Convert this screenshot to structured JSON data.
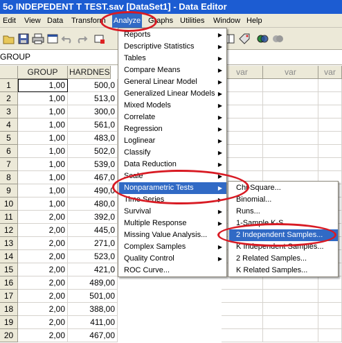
{
  "window": {
    "title": "5o INDEPEDENT T TEST.sav [DataSet1] -      Data Editor"
  },
  "menubar": {
    "items": [
      "Edit",
      "View",
      "Data",
      "Transform",
      "Analyze",
      "Graphs",
      "Utilities",
      "Window",
      "Help"
    ],
    "active": "Analyze"
  },
  "varbar": {
    "name": "GROUP"
  },
  "grid": {
    "columns": [
      "GROUP",
      "HARDNES",
      "var",
      "var",
      "var"
    ],
    "rows": [
      {
        "n": "1",
        "group": "1,00",
        "hardness": "500,0"
      },
      {
        "n": "2",
        "group": "1,00",
        "hardness": "513,0"
      },
      {
        "n": "3",
        "group": "1,00",
        "hardness": "300,0"
      },
      {
        "n": "4",
        "group": "1,00",
        "hardness": "561,0"
      },
      {
        "n": "5",
        "group": "1,00",
        "hardness": "483,0"
      },
      {
        "n": "6",
        "group": "1,00",
        "hardness": "502,0"
      },
      {
        "n": "7",
        "group": "1,00",
        "hardness": "539,0"
      },
      {
        "n": "8",
        "group": "1,00",
        "hardness": "467,0"
      },
      {
        "n": "9",
        "group": "1,00",
        "hardness": "490,0"
      },
      {
        "n": "10",
        "group": "1,00",
        "hardness": "480,0"
      },
      {
        "n": "11",
        "group": "2,00",
        "hardness": "392,0"
      },
      {
        "n": "12",
        "group": "2,00",
        "hardness": "445,0"
      },
      {
        "n": "13",
        "group": "2,00",
        "hardness": "271,0"
      },
      {
        "n": "14",
        "group": "2,00",
        "hardness": "523,0"
      },
      {
        "n": "15",
        "group": "2,00",
        "hardness": "421,0"
      },
      {
        "n": "16",
        "group": "2,00",
        "hardness": "489,00"
      },
      {
        "n": "17",
        "group": "2,00",
        "hardness": "501,00"
      },
      {
        "n": "18",
        "group": "2,00",
        "hardness": "388,00"
      },
      {
        "n": "19",
        "group": "2,00",
        "hardness": "411,00"
      },
      {
        "n": "20",
        "group": "2,00",
        "hardness": "467,00"
      }
    ]
  },
  "analyze_menu": {
    "items": [
      {
        "label": "Reports",
        "submenu": true
      },
      {
        "label": "Descriptive Statistics",
        "submenu": true
      },
      {
        "label": "Tables",
        "submenu": true
      },
      {
        "label": "Compare Means",
        "submenu": true
      },
      {
        "label": "General Linear Model",
        "submenu": true
      },
      {
        "label": "Generalized Linear Models",
        "submenu": true
      },
      {
        "label": "Mixed Models",
        "submenu": true
      },
      {
        "label": "Correlate",
        "submenu": true
      },
      {
        "label": "Regression",
        "submenu": true
      },
      {
        "label": "Loglinear",
        "submenu": true
      },
      {
        "label": "Classify",
        "submenu": true
      },
      {
        "label": "Data Reduction",
        "submenu": true
      },
      {
        "label": "Scale",
        "submenu": true
      },
      {
        "label": "Nonparametric Tests",
        "submenu": true
      },
      {
        "label": "Time Series",
        "submenu": true
      },
      {
        "label": "Survival",
        "submenu": true
      },
      {
        "label": "Multiple Response",
        "submenu": true
      },
      {
        "label": "Missing Value Analysis...",
        "submenu": false
      },
      {
        "label": "Complex Samples",
        "submenu": true
      },
      {
        "label": "Quality Control",
        "submenu": true
      },
      {
        "label": "ROC Curve...",
        "submenu": false
      }
    ],
    "highlighted": "Nonparametric Tests"
  },
  "nonparametric_submenu": {
    "items": [
      "Chi-Square...",
      "Binomial...",
      "Runs...",
      "1-Sample K-S...",
      "2 Independent Samples...",
      "K Independent Samples...",
      "2 Related Samples...",
      "K Related Samples..."
    ],
    "highlighted": "2 Independent Samples..."
  },
  "toolbar": {
    "icons": [
      "open-icon",
      "save-icon",
      "print-icon",
      "dialog-recall-icon",
      "undo-icon",
      "redo-icon",
      "goto-case-icon",
      "insert-variable-icon",
      "value-labels-icon",
      "use-sets-icon",
      "show-sets-icon"
    ]
  },
  "annotation": {
    "color": "#d81b24"
  },
  "colors": {
    "titlebar": "#1c5cd2",
    "menu_bg": "#ece9d8",
    "highlight": "#316ac5"
  }
}
